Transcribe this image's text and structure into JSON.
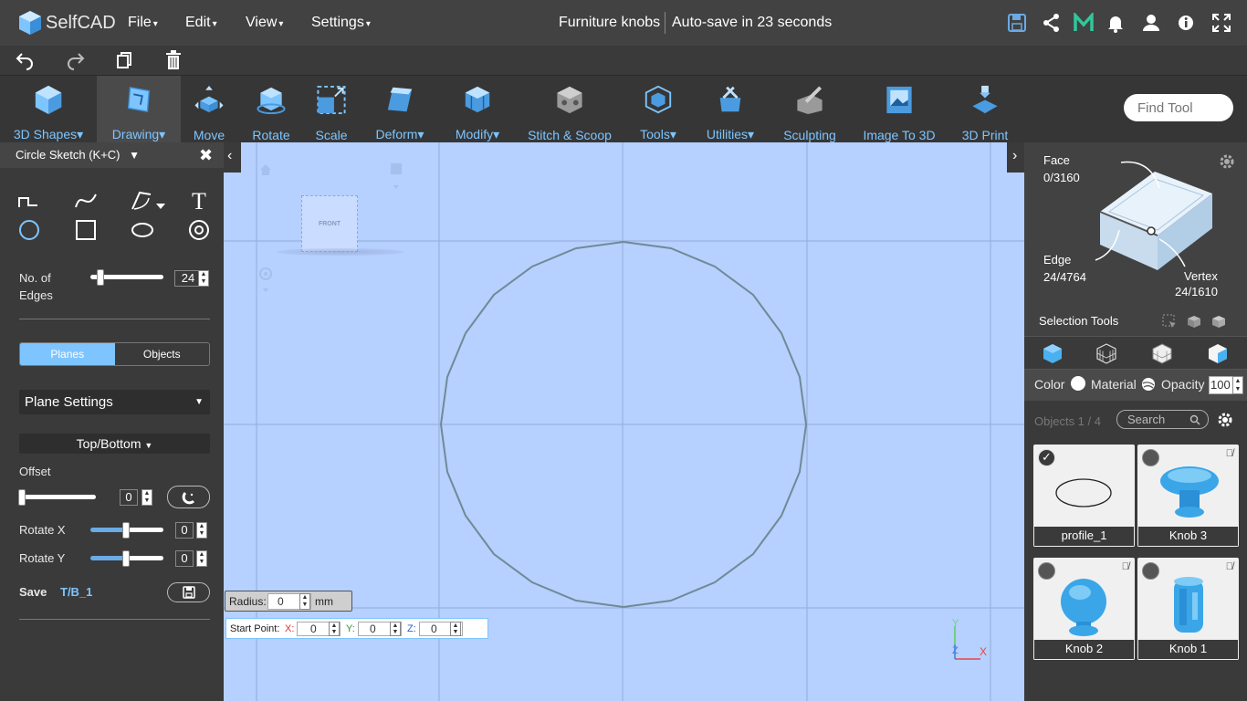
{
  "app": {
    "logo_text": "SelfCAD"
  },
  "menu": {
    "file": "File",
    "edit": "Edit",
    "view": "View",
    "settings": "Settings"
  },
  "doc": {
    "title": "Furniture knobs",
    "autosave": "Auto-save in 23 seconds"
  },
  "toolbar": {
    "items": [
      {
        "label": "3D Shapes",
        "dropdown": true
      },
      {
        "label": "Drawing",
        "dropdown": true
      },
      {
        "label": "Move",
        "dropdown": false
      },
      {
        "label": "Rotate",
        "dropdown": false
      },
      {
        "label": "Scale",
        "dropdown": false
      },
      {
        "label": "Deform",
        "dropdown": true
      },
      {
        "label": "Modify",
        "dropdown": true
      },
      {
        "label": "Stitch & Scoop",
        "dropdown": false
      },
      {
        "label": "Tools",
        "dropdown": true
      },
      {
        "label": "Utilities",
        "dropdown": true
      },
      {
        "label": "Sculpting",
        "dropdown": false
      },
      {
        "label": "Image To 3D",
        "dropdown": false
      },
      {
        "label": "3D Print",
        "dropdown": false
      }
    ],
    "find_placeholder": "Find Tool"
  },
  "left": {
    "title": "Circle Sketch (K+C)",
    "edges_label_1": "No. of",
    "edges_label_2": "Edges",
    "edges_value": "24",
    "tab_planes": "Planes",
    "tab_objects": "Objects",
    "plane_settings": "Plane Settings",
    "top_bottom": "Top/Bottom",
    "offset_label": "Offset",
    "offset_value": "0",
    "rotx_label": "Rotate X",
    "rotx_value": "0",
    "roty_label": "Rotate Y",
    "roty_value": "0",
    "save_label": "Save",
    "save_name": "T/B_1"
  },
  "viewport": {
    "cube_label": "FRONT",
    "radius_label": "Radius:",
    "radius_value": "0",
    "radius_unit": "mm",
    "start_label": "Start Point:",
    "x_label": "X:",
    "x_value": "0",
    "y_label": "Y:",
    "y_value": "0",
    "z_label": "Z:",
    "z_value": "0",
    "axis_y": "Y",
    "axis_z": "Z",
    "axis_x": "X"
  },
  "right": {
    "face_label": "Face",
    "face_count": "0/3160",
    "edge_label": "Edge",
    "edge_count": "24/4764",
    "vertex_label": "Vertex",
    "vertex_count": "24/1610",
    "selection_tools": "Selection Tools",
    "color_label": "Color",
    "material_label": "Material",
    "opacity_label": "Opacity",
    "opacity_value": "100",
    "objects_count": "Objects 1 / 4",
    "search_placeholder": "Search",
    "objects": [
      {
        "name": "profile_1",
        "checked": true,
        "hidden": false
      },
      {
        "name": "Knob 3",
        "checked": false,
        "hidden": true
      },
      {
        "name": "Knob 2",
        "checked": false,
        "hidden": true
      },
      {
        "name": "Knob 1",
        "checked": false,
        "hidden": true
      }
    ]
  },
  "colors": {
    "accent": "#7ec5ff",
    "viewport_bg": "#b6d0ff",
    "panel": "#3a3a3a",
    "topbar": "#424242",
    "sketch_line": "#6f8a95"
  }
}
